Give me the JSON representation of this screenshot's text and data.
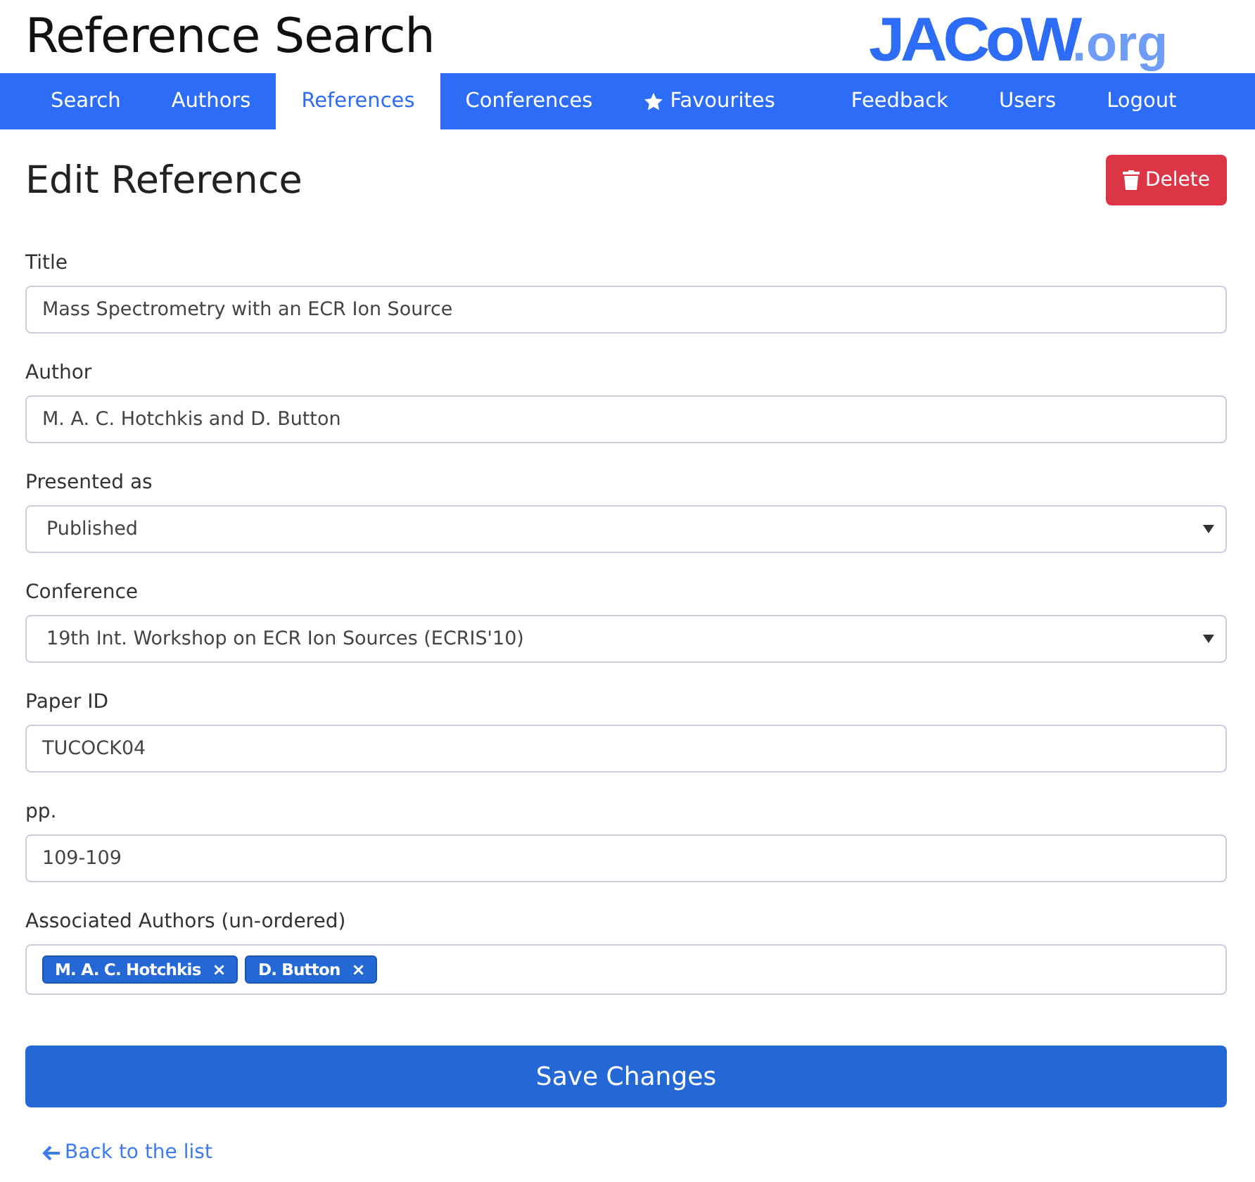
{
  "header": {
    "title": "Reference Search",
    "logo": {
      "main": "JACoW",
      "suffix": ".org"
    }
  },
  "nav": [
    {
      "label": "Search",
      "selected": false,
      "kind": "plain"
    },
    {
      "label": "Authors",
      "selected": false,
      "kind": "plain"
    },
    {
      "label": "References",
      "selected": true,
      "kind": "plain"
    },
    {
      "label": "Conferences",
      "selected": false,
      "kind": "plain"
    },
    {
      "label": "Favourites",
      "selected": false,
      "kind": "starred"
    },
    {
      "label": "Feedback",
      "selected": false,
      "kind": "plain"
    },
    {
      "label": "Users",
      "selected": false,
      "kind": "plain"
    },
    {
      "label": "Logout",
      "selected": false,
      "kind": "plain"
    }
  ],
  "page": {
    "heading": "Edit Reference",
    "delete_button": "Delete"
  },
  "fields": [
    {
      "kind": "text",
      "label": "Title",
      "value": "Mass Spectrometry with an ECR Ion Source"
    },
    {
      "kind": "text",
      "label": "Author",
      "value": "M. A. C. Hotchkis and D. Button"
    },
    {
      "kind": "select",
      "label": "Presented as",
      "value": "Published"
    },
    {
      "kind": "select",
      "label": "Conference",
      "value": "19th Int. Workshop on ECR Ion Sources (ECRIS'10)"
    },
    {
      "kind": "text",
      "label": "Paper ID",
      "value": "TUCOCK04"
    },
    {
      "kind": "text",
      "label": "pp.",
      "value": "109-109"
    },
    {
      "kind": "tags",
      "label": "Associated Authors (un-ordered)",
      "tags": [
        {
          "text": "M. A. C. Hotchkis",
          "remove": "×"
        },
        {
          "text": "D. Button",
          "remove": "×"
        }
      ]
    }
  ],
  "save_button": "Save Changes",
  "back_link": "Back to the list"
}
